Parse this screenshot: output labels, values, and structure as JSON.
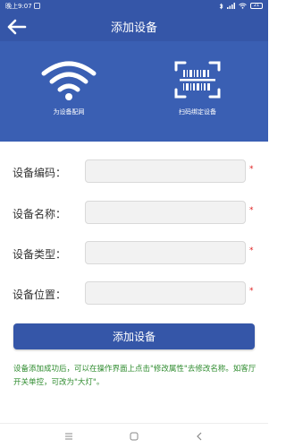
{
  "status_bar": {
    "time": "晚上9:07",
    "battery": "21"
  },
  "header": {
    "title": "添加设备"
  },
  "hero": {
    "network_label": "为设备配网",
    "scan_label": "扫码绑定设备"
  },
  "form": {
    "fields": [
      {
        "label": "设备编码：",
        "value": "",
        "placeholder": ""
      },
      {
        "label": "设备名称：",
        "value": "",
        "placeholder": ""
      },
      {
        "label": "设备类型：",
        "value": "",
        "placeholder": ""
      },
      {
        "label": "设备位置：",
        "value": "",
        "placeholder": ""
      }
    ],
    "required_mark": "*"
  },
  "submit_label": "添加设备",
  "hint": "设备添加成功后，可以在操作界面上点击\"修改属性\"去修改名称。如客厅开关单控，可改为\"大灯\"。",
  "colors": {
    "primary": "#3556a8",
    "hero_bg": "#3a5fb3",
    "required": "#e02020",
    "hint": "#2e8b2e"
  },
  "icons": {
    "back": "arrow-left-icon",
    "wifi": "wifi-icon",
    "scan": "qr-scan-icon",
    "nav_menu": "menu-icon",
    "nav_home": "home-icon",
    "nav_back": "chevron-left-icon"
  }
}
